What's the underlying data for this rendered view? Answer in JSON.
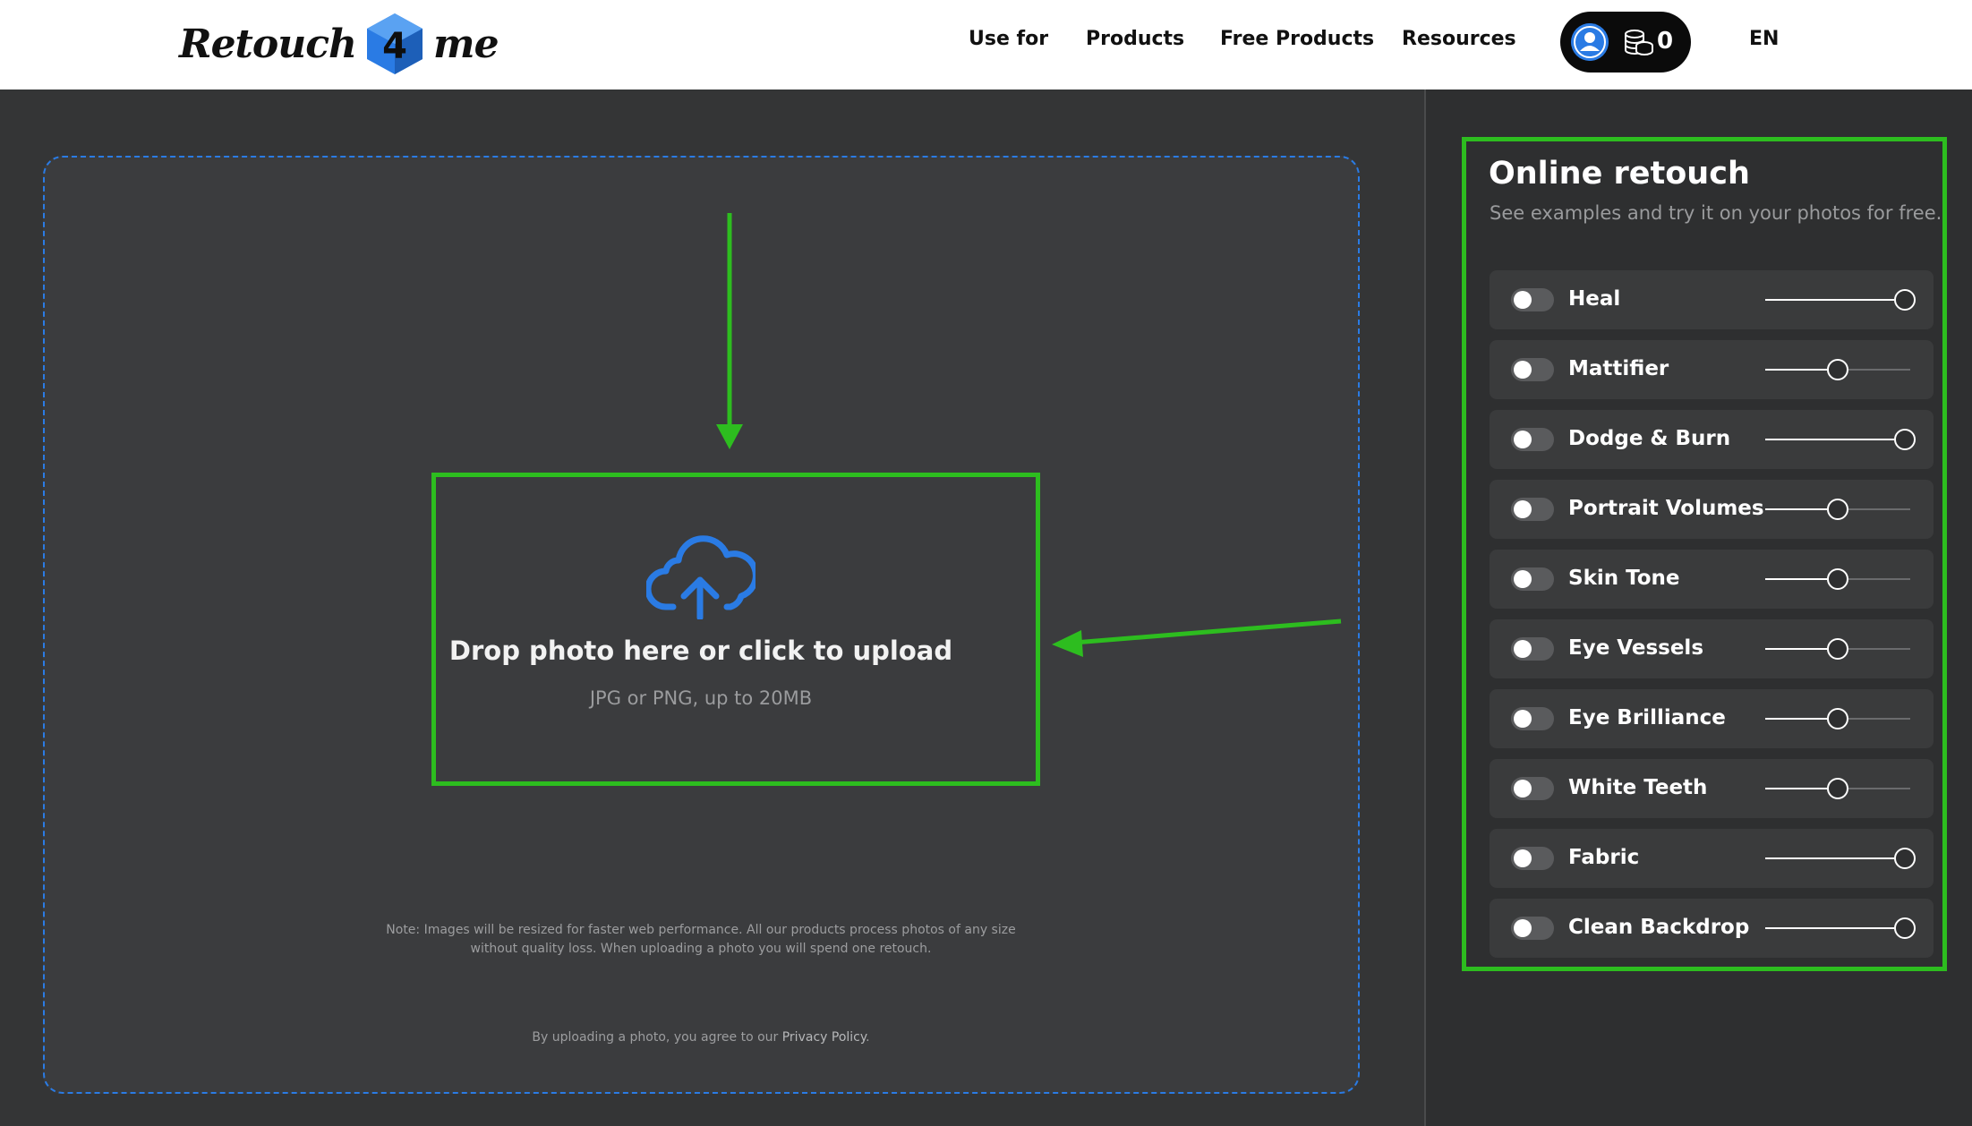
{
  "header": {
    "logo": {
      "left": "Retouch",
      "mark": "4",
      "right": "me"
    },
    "nav": [
      {
        "label": "Use for"
      },
      {
        "label": "Products"
      },
      {
        "label": "Free Products"
      },
      {
        "label": "Resources"
      }
    ],
    "account": {
      "icon": "user-icon",
      "coins_icon": "coins-icon",
      "coins": "0"
    },
    "language": "EN"
  },
  "upload": {
    "icon": "cloud-upload-icon",
    "title": "Drop photo here or click to upload",
    "subtitle": "JPG or PNG, up to 20MB",
    "note": "Note: Images will be resized for faster web performance. All our products process photos of any size without quality loss. When uploading a photo you will spend one retouch.",
    "privacy_prefix": "By uploading a photo, you agree to our ",
    "privacy_link": "Privacy Policy",
    "privacy_suffix": "."
  },
  "panel": {
    "title": "Online retouch",
    "subtitle": "See examples and try it on your photos for free.",
    "tools": [
      {
        "label": "Heal",
        "enabled": false,
        "value": 100
      },
      {
        "label": "Mattifier",
        "enabled": false,
        "value": 50
      },
      {
        "label": "Dodge & Burn",
        "enabled": false,
        "value": 100
      },
      {
        "label": "Portrait Volumes",
        "enabled": false,
        "value": 50
      },
      {
        "label": "Skin Tone",
        "enabled": false,
        "value": 50
      },
      {
        "label": "Eye Vessels",
        "enabled": false,
        "value": 50
      },
      {
        "label": "Eye Brilliance",
        "enabled": false,
        "value": 50
      },
      {
        "label": "White Teeth",
        "enabled": false,
        "value": 50
      },
      {
        "label": "Fabric",
        "enabled": false,
        "value": 100
      },
      {
        "label": "Clean Backdrop",
        "enabled": false,
        "value": 100
      }
    ]
  },
  "colors": {
    "accent_blue": "#2a7be4",
    "highlight_green": "#2dbd1f",
    "background": "#343536",
    "panel": "#2e2f30"
  }
}
